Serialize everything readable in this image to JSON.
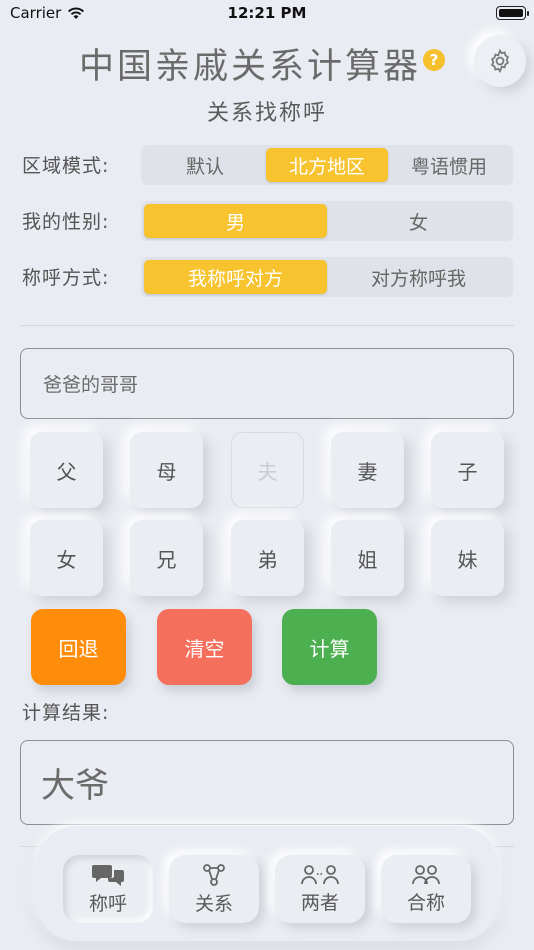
{
  "status": {
    "carrier": "Carrier",
    "time": "12:21 PM"
  },
  "header": {
    "title": "中国亲戚关系计算器",
    "help": "?",
    "subtitle": "关系找称呼"
  },
  "region": {
    "label": "区域模式:",
    "options": [
      "默认",
      "北方地区",
      "粤语惯用"
    ],
    "selected": "北方地区"
  },
  "gender": {
    "label": "我的性别:",
    "options": [
      "男",
      "女"
    ],
    "selected": "男"
  },
  "address": {
    "label": "称呼方式:",
    "options": [
      "我称呼对方",
      "对方称呼我"
    ],
    "selected": "我称呼对方"
  },
  "input": {
    "value": "爸爸的哥哥"
  },
  "keys": {
    "row1": [
      "父",
      "母",
      "夫",
      "妻",
      "子"
    ],
    "row2": [
      "女",
      "兄",
      "弟",
      "姐",
      "妹"
    ],
    "disabled": [
      "夫"
    ]
  },
  "actions": {
    "back": "回退",
    "clear": "清空",
    "calc": "计算"
  },
  "result": {
    "label": "计算结果:",
    "value": "大爷"
  },
  "tabs": [
    {
      "label": "称呼",
      "icon": "chat-bubbles-icon",
      "active": true
    },
    {
      "label": "关系",
      "icon": "relation-network-icon",
      "active": false
    },
    {
      "label": "两者",
      "icon": "two-people-icon",
      "active": false
    },
    {
      "label": "合称",
      "icon": "group-people-icon",
      "active": false
    }
  ],
  "colors": {
    "accent": "#f7c32e",
    "back": "#ff8c0a",
    "clear": "#f46f5c",
    "calc": "#4caf50"
  }
}
